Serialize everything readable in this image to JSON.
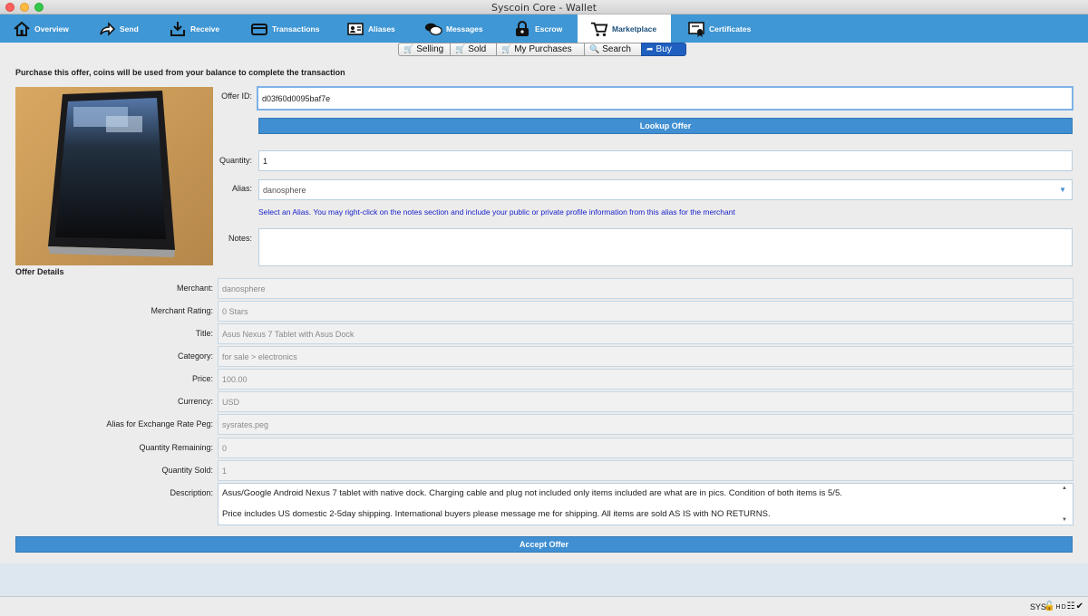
{
  "window": {
    "title": "Syscoin Core - Wallet"
  },
  "nav": {
    "items": [
      {
        "label": "Overview",
        "icon": "house-icon"
      },
      {
        "label": "Send",
        "icon": "send-arrow-icon"
      },
      {
        "label": "Receive",
        "icon": "receive-tray-icon"
      },
      {
        "label": "Transactions",
        "icon": "wallet-card-icon"
      },
      {
        "label": "Aliases",
        "icon": "id-card-icon"
      },
      {
        "label": "Messages",
        "icon": "chat-bubbles-icon"
      },
      {
        "label": "Escrow",
        "icon": "lock-icon"
      },
      {
        "label": "Marketplace",
        "icon": "cart-icon"
      },
      {
        "label": "Certificates",
        "icon": "certificate-icon"
      }
    ],
    "active": "Marketplace",
    "bar_color": "#3f97d5"
  },
  "subtabs": {
    "items": [
      {
        "label": "Selling",
        "icon": "cart-icon"
      },
      {
        "label": "Sold",
        "icon": "cart-icon"
      },
      {
        "label": "My Purchases",
        "icon": "cart-icon"
      },
      {
        "label": "Search",
        "icon": "magnifier-icon"
      },
      {
        "label": "Buy",
        "icon": "arrow-icon"
      }
    ],
    "active": "Buy"
  },
  "buy": {
    "headline": "Purchase this offer, coins will be used from your balance to complete the transaction",
    "offer_id_label": "Offer ID:",
    "offer_id_value": "d03f60d0095baf7e",
    "lookup_button": "Lookup Offer",
    "quantity_label": "Quantity:",
    "quantity_value": "1",
    "alias_label": "Alias:",
    "alias_value": "danosphere",
    "alias_hint": "Select an Alias. You may right-click on the notes section and include your public or private profile information from this alias for the merchant",
    "notes_label": "Notes:",
    "notes_value": ""
  },
  "offer_details": {
    "section_title": "Offer Details",
    "fields": [
      {
        "label": "Merchant:",
        "value": "danosphere"
      },
      {
        "label": "Merchant Rating:",
        "value": "0 Stars"
      },
      {
        "label": "Title:",
        "value": "Asus Nexus 7 Tablet with Asus Dock"
      },
      {
        "label": "Category:",
        "value": "for sale > electronics"
      },
      {
        "label": "Price:",
        "value": "100.00"
      },
      {
        "label": "Currency:",
        "value": "USD"
      },
      {
        "label": "Alias for Exchange Rate Peg:",
        "value": "sysrates.peg"
      },
      {
        "label": "Quantity Remaining:",
        "value": "0"
      },
      {
        "label": "Quantity Sold:",
        "value": "1"
      }
    ],
    "description_label": "Description:",
    "description_lines": [
      "Asus/Google Android Nexus 7 tablet with native dock. Charging cable and plug not included only items included are what are in pics. Condition of both items is 5/5.",
      "Price includes US domestic 2-5day shipping. International buyers please message me for shipping. All items are sold AS IS with NO RETURNS."
    ]
  },
  "accept_button": "Accept Offer",
  "status": {
    "unit": "SYS",
    "icons": [
      "lock-icon",
      "hd-icon",
      "network-icon",
      "sync-check-icon"
    ]
  }
}
